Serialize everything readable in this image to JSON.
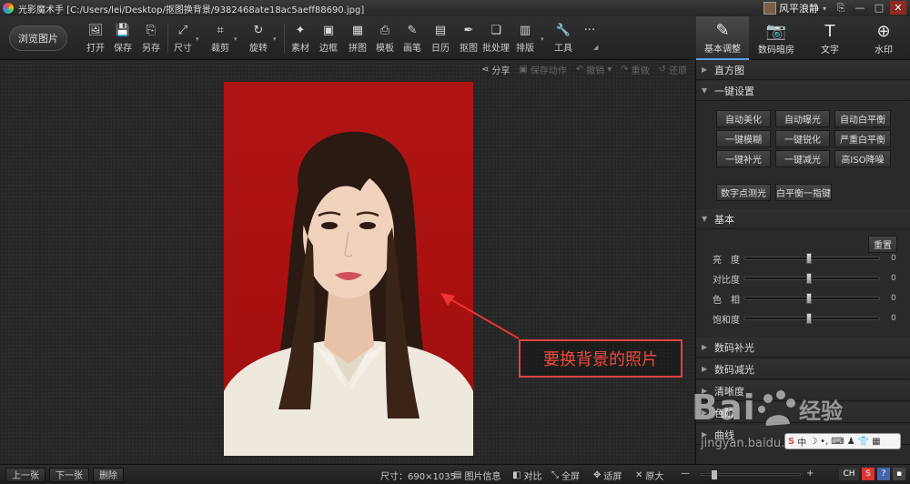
{
  "titlebar": {
    "app_name": "光影魔术手",
    "file_path": "[C:/Users/lei/Desktop/抠图换背景/9382468ate18ac5aeff88690.jpg]",
    "user_name": "风平浪静",
    "caret": "▾",
    "win_buttons": [
      "⎘",
      "—",
      "□",
      "✕"
    ]
  },
  "toolbar": {
    "browse": "浏览图片",
    "tools": [
      {
        "label": "打开",
        "icon": "🖼"
      },
      {
        "label": "保存",
        "icon": "💾"
      },
      {
        "label": "另存",
        "icon": "⎘"
      },
      {
        "label": "尺寸",
        "icon": "⤢"
      },
      {
        "label": "裁剪",
        "icon": "⌗"
      },
      {
        "label": "旋转",
        "icon": "↻"
      },
      {
        "label": "素材",
        "icon": "✦"
      },
      {
        "label": "边框",
        "icon": "▣"
      },
      {
        "label": "拼图",
        "icon": "▦"
      },
      {
        "label": "模板",
        "icon": "⎙"
      },
      {
        "label": "画笔",
        "icon": "✎"
      },
      {
        "label": "日历",
        "icon": "▤"
      },
      {
        "label": "抠图",
        "icon": "✒"
      },
      {
        "label": "批处理",
        "icon": "❏"
      },
      {
        "label": "排版",
        "icon": "▥"
      },
      {
        "label": "工具",
        "icon": "🔧"
      }
    ],
    "more": "···",
    "right_tabs": [
      {
        "label": "基本调整",
        "icon": "✎"
      },
      {
        "label": "数码暗房",
        "icon": "📷"
      },
      {
        "label": "文字",
        "icon": "T"
      },
      {
        "label": "水印",
        "icon": "⊕"
      }
    ]
  },
  "canvas_top": {
    "share": "分享",
    "save_action": "保存动作",
    "undo": "撤销",
    "redo": "重做",
    "restore": "还原"
  },
  "annotation": {
    "text": "要换背景的照片"
  },
  "panel": {
    "histogram": "直方图",
    "one_click": "一键设置",
    "one_click_buttons": [
      "自动美化",
      "自动曝光",
      "自动白平衡",
      "一键模糊",
      "一键锐化",
      "严重白平衡",
      "一键补光",
      "一键减光",
      "高ISO降噪"
    ],
    "extra_buttons": [
      "数字点测光",
      "白平衡一指键"
    ],
    "basic": "基本",
    "reset": "重置",
    "sliders": [
      {
        "label": "亮　度",
        "value": "0",
        "position": 0.47
      },
      {
        "label": "对比度",
        "value": "0",
        "position": 0.47
      },
      {
        "label": "色　相",
        "value": "0",
        "position": 0.47
      },
      {
        "label": "饱和度",
        "value": "0",
        "position": 0.47
      }
    ],
    "sections": [
      "数码补光",
      "数码减光",
      "清晰度",
      "色阶",
      "曲线"
    ]
  },
  "statusbar": {
    "prev": "上一张",
    "next": "下一张",
    "delete": "删除",
    "size": "尺寸：690×1035",
    "image_info": "图片信息",
    "compare": "对比",
    "fullscreen": "全屏",
    "fit": "适屏",
    "original": "原大",
    "zoom_level": 0.1
  },
  "watermark": {
    "brand": "Bai",
    "brand2": "经验",
    "url": "jingyan.baidu.com"
  },
  "ime": {
    "label": "中"
  }
}
